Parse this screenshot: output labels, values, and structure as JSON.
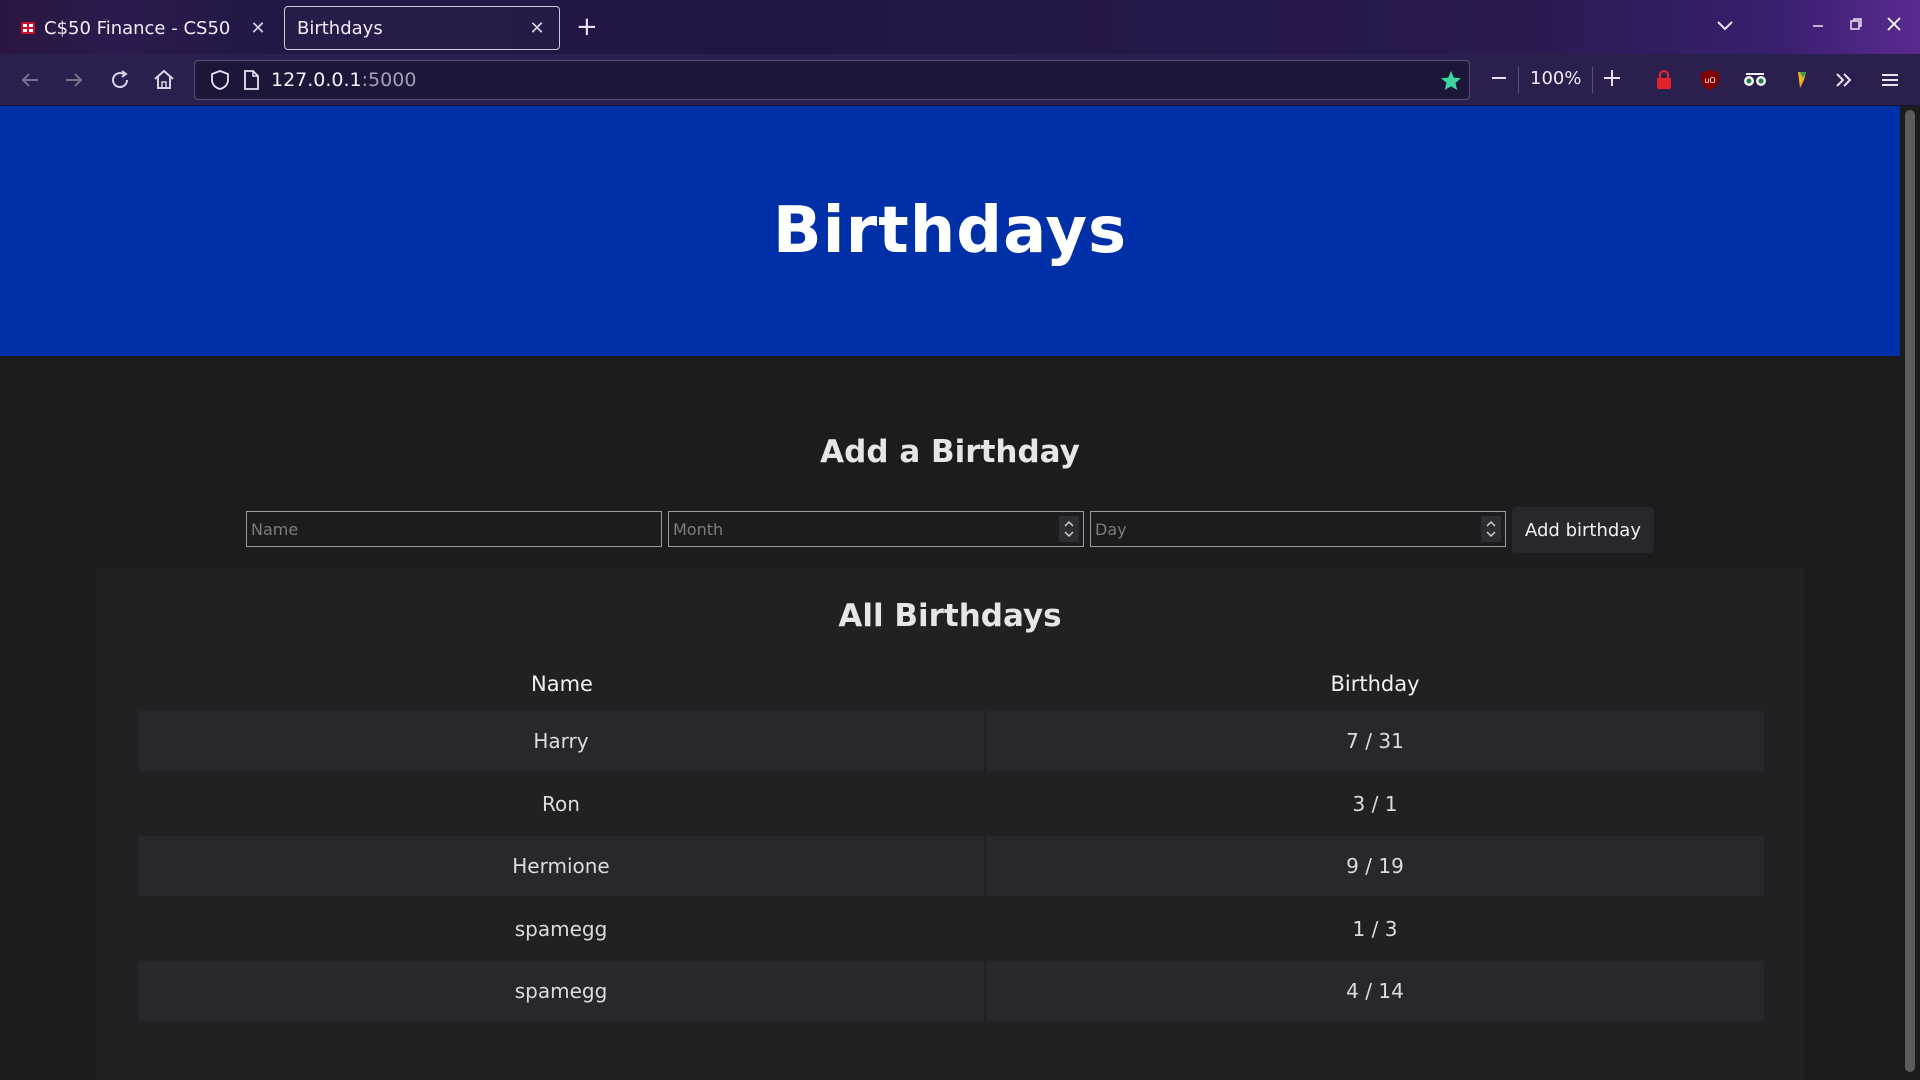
{
  "browser": {
    "tabs": [
      {
        "title": "C$50 Finance - CS50",
        "active": false,
        "favicon": "cs50-favicon-icon"
      },
      {
        "title": "Birthdays",
        "active": true,
        "favicon": "none"
      }
    ],
    "url_host": "127.0.0.1",
    "url_port": ":5000",
    "zoom": "100%",
    "colors": {
      "accent_star": "#3dd6a0",
      "lock_red": "#e0242c"
    }
  },
  "page": {
    "hero_title": "Birthdays",
    "add_heading": "Add a Birthday",
    "form": {
      "name_placeholder": "Name",
      "month_placeholder": "Month",
      "day_placeholder": "Day",
      "submit_label": "Add birthday"
    },
    "list_heading": "All Birthdays",
    "table": {
      "headers": [
        "Name",
        "Birthday"
      ],
      "rows": [
        {
          "name": "Harry",
          "birthday": "7 / 31"
        },
        {
          "name": "Ron",
          "birthday": "3 / 1"
        },
        {
          "name": "Hermione",
          "birthday": "9 / 19"
        },
        {
          "name": "spamegg",
          "birthday": "1 / 3"
        },
        {
          "name": "spamegg",
          "birthday": "4 / 14"
        }
      ]
    },
    "colors": {
      "hero_bg": "#0030a8",
      "page_bg": "#1b1c1e"
    }
  }
}
